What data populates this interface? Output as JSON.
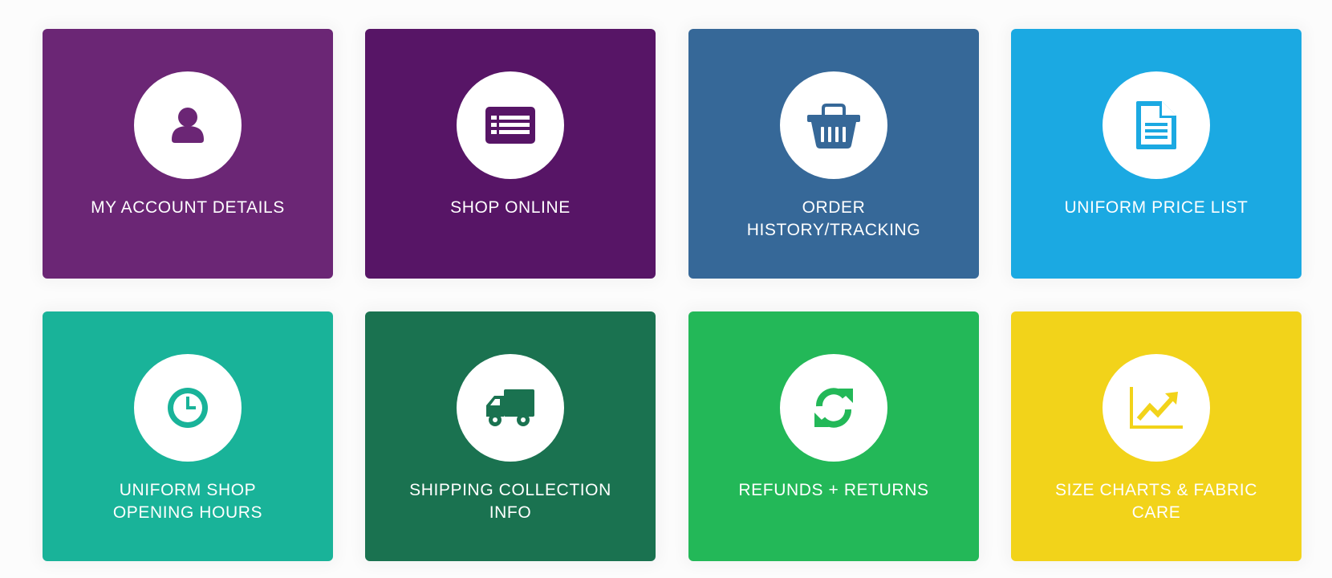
{
  "tiles": [
    {
      "label": "MY ACCOUNT DETAILS",
      "icon": "user-icon",
      "color": "#6b2675"
    },
    {
      "label": "SHOP ONLINE",
      "icon": "list-icon",
      "color": "#571566"
    },
    {
      "label": "ORDER\nHISTORY/TRACKING",
      "icon": "basket-icon",
      "color": "#366898"
    },
    {
      "label": "UNIFORM PRICE LIST",
      "icon": "document-icon",
      "color": "#1ba9e2"
    },
    {
      "label": "UNIFORM SHOP\nOPENING HOURS",
      "icon": "clock-icon",
      "color": "#19b399"
    },
    {
      "label": "SHIPPING COLLECTION\nINFO",
      "icon": "truck-icon",
      "color": "#1a7250"
    },
    {
      "label": "REFUNDS + RETURNS",
      "icon": "refresh-icon",
      "color": "#23b858"
    },
    {
      "label": "SIZE CHARTS & FABRIC\nCARE",
      "icon": "line-chart-icon",
      "color": "#f2d31a"
    }
  ]
}
